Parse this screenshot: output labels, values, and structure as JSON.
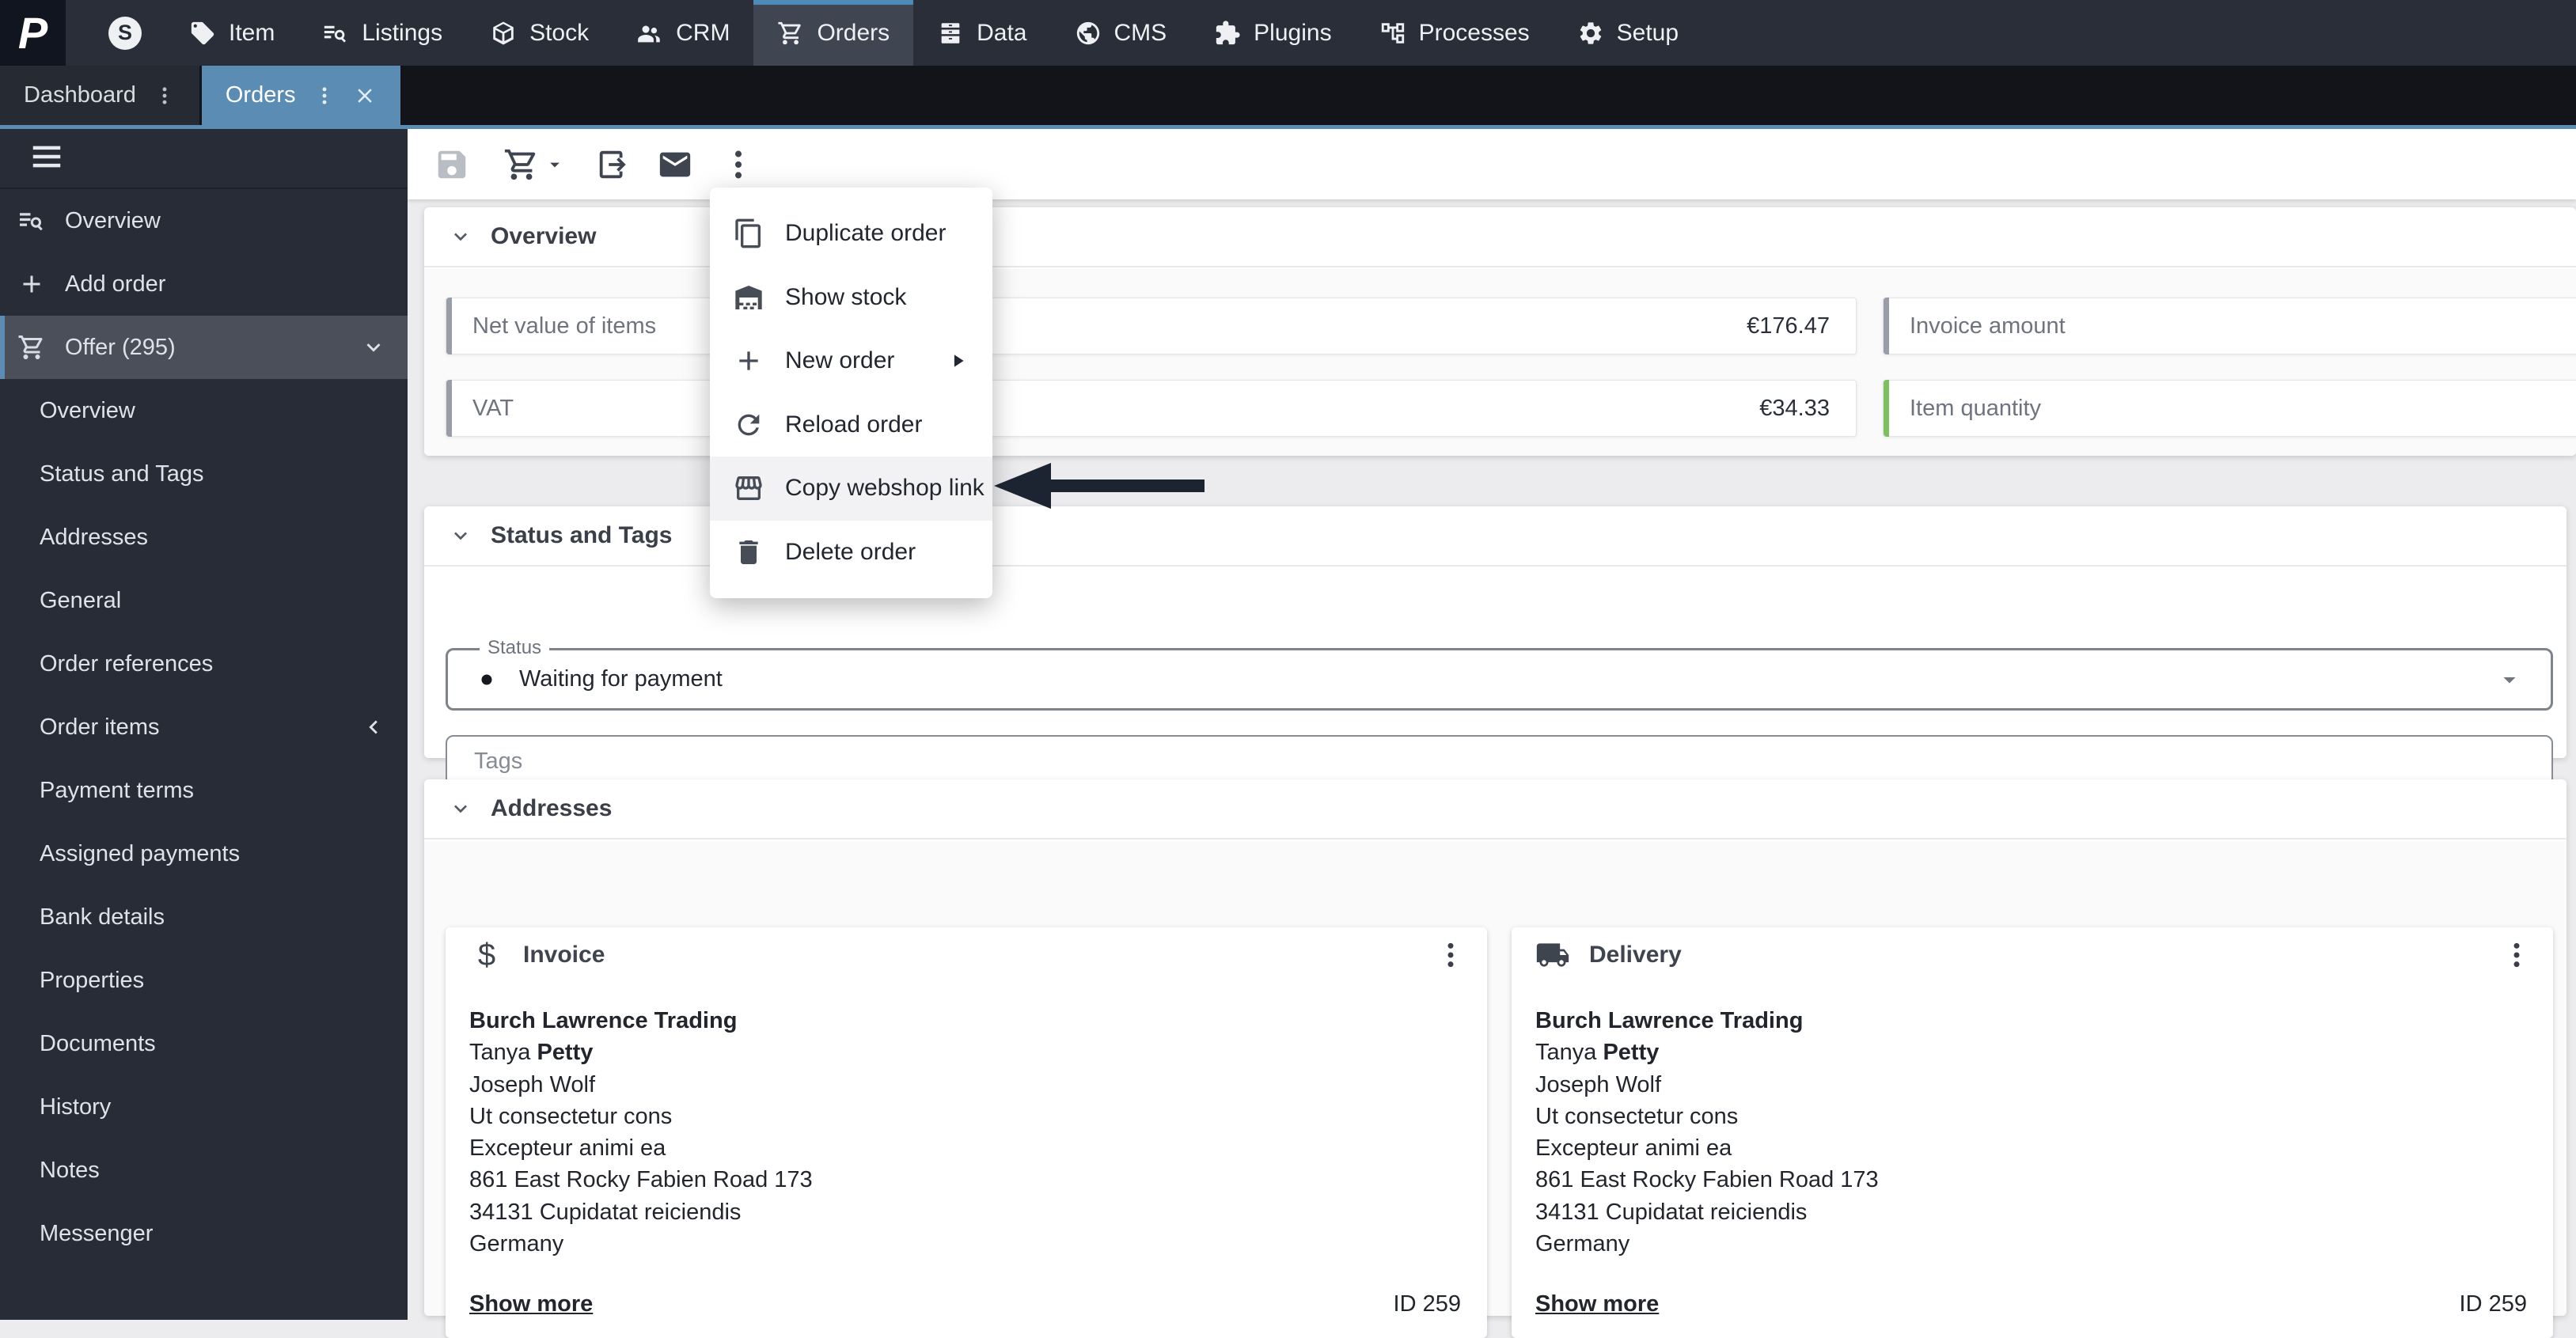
{
  "topnav": {
    "items": [
      {
        "icon": "s-badge",
        "label": ""
      },
      {
        "icon": "tag",
        "label": "Item"
      },
      {
        "icon": "listings",
        "label": "Listings"
      },
      {
        "icon": "stock",
        "label": "Stock"
      },
      {
        "icon": "crm",
        "label": "CRM"
      },
      {
        "icon": "cart",
        "label": "Orders",
        "active": true
      },
      {
        "icon": "data",
        "label": "Data"
      },
      {
        "icon": "cms",
        "label": "CMS"
      },
      {
        "icon": "plugins",
        "label": "Plugins"
      },
      {
        "icon": "processes",
        "label": "Processes"
      },
      {
        "icon": "setup",
        "label": "Setup"
      }
    ]
  },
  "tabs": {
    "items": [
      {
        "label": "Dashboard",
        "active": false,
        "closable": false
      },
      {
        "label": "Orders",
        "active": true,
        "closable": true
      }
    ]
  },
  "sidebar": {
    "items": [
      {
        "label": "Overview",
        "icon": "overview-search",
        "level": "top"
      },
      {
        "label": "Add order",
        "icon": "plus",
        "level": "top"
      },
      {
        "label": "Offer (295)",
        "icon": "cart",
        "level": "top",
        "active": true,
        "trailing": "chevron-down"
      },
      {
        "label": "Overview",
        "level": "sub"
      },
      {
        "label": "Status and Tags",
        "level": "sub"
      },
      {
        "label": "Addresses",
        "level": "sub"
      },
      {
        "label": "General",
        "level": "sub"
      },
      {
        "label": "Order references",
        "level": "sub"
      },
      {
        "label": "Order items",
        "level": "sub",
        "trailing": "chevron-left"
      },
      {
        "label": "Payment terms",
        "level": "sub"
      },
      {
        "label": "Assigned payments",
        "level": "sub"
      },
      {
        "label": "Bank details",
        "level": "sub"
      },
      {
        "label": "Properties",
        "level": "sub"
      },
      {
        "label": "Documents",
        "level": "sub"
      },
      {
        "label": "History",
        "level": "sub"
      },
      {
        "label": "Notes",
        "level": "sub"
      },
      {
        "label": "Messenger",
        "level": "sub"
      }
    ]
  },
  "toolbar": {
    "buttons": [
      {
        "icon": "save",
        "disabled": true
      },
      {
        "icon": "cart",
        "caret": true
      },
      {
        "icon": "export"
      },
      {
        "icon": "mail"
      },
      {
        "icon": "kebab"
      }
    ]
  },
  "context_menu": {
    "items": [
      {
        "icon": "copy",
        "label": "Duplicate order"
      },
      {
        "icon": "warehouse",
        "label": "Show stock"
      },
      {
        "icon": "plus",
        "label": "New order",
        "submenu": true
      },
      {
        "icon": "reload",
        "label": "Reload order"
      },
      {
        "icon": "store",
        "label": "Copy webshop link",
        "highlighted": true
      },
      {
        "icon": "trash",
        "label": "Delete order"
      }
    ]
  },
  "overview_section": {
    "title": "Overview",
    "fields": [
      {
        "label": "Net value of items",
        "value": "€176.47",
        "bar_color": "#999ea6",
        "row": 0,
        "col": "left"
      },
      {
        "label": "VAT",
        "value": "€34.33",
        "bar_color": "#999ea6",
        "row": 1,
        "col": "left"
      },
      {
        "label": "Invoice amount",
        "value": "",
        "bar_color": "#999ea6",
        "row": 0,
        "col": "right"
      },
      {
        "label": "Item quantity",
        "value": "",
        "bar_color": "#7cc15f",
        "row": 1,
        "col": "right"
      }
    ]
  },
  "status_section": {
    "title": "Status and Tags",
    "status_label": "Status",
    "status_value": "Waiting for payment",
    "tags_placeholder": "Tags"
  },
  "addresses_section": {
    "title": "Addresses",
    "cards": [
      {
        "icon": "dollar",
        "title": "Invoice",
        "lines": [
          [
            {
              "t": "Burch Lawrence Trading",
              "b": true
            }
          ],
          [
            {
              "t": "Tanya ",
              "b": false
            },
            {
              "t": "Petty",
              "b": true
            }
          ],
          [
            {
              "t": "Joseph Wolf",
              "b": false
            }
          ],
          [
            {
              "t": "Ut consectetur cons",
              "b": false
            }
          ],
          [
            {
              "t": "Excepteur animi ea",
              "b": false
            }
          ],
          [
            {
              "t": "861 East Rocky Fabien Road 173",
              "b": false
            }
          ],
          [
            {
              "t": "34131 Cupidatat reiciendis",
              "b": false
            }
          ],
          [
            {
              "t": "Germany",
              "b": false
            }
          ]
        ],
        "show_more": "Show more",
        "id_label": "ID 259"
      },
      {
        "icon": "truck",
        "title": "Delivery",
        "lines": [
          [
            {
              "t": "Burch Lawrence Trading",
              "b": true
            }
          ],
          [
            {
              "t": "Tanya ",
              "b": false
            },
            {
              "t": "Petty",
              "b": true
            }
          ],
          [
            {
              "t": "Joseph Wolf",
              "b": false
            }
          ],
          [
            {
              "t": "Ut consectetur cons",
              "b": false
            }
          ],
          [
            {
              "t": "Excepteur animi ea",
              "b": false
            }
          ],
          [
            {
              "t": "861 East Rocky Fabien Road 173",
              "b": false
            }
          ],
          [
            {
              "t": "34131 Cupidatat reiciendis",
              "b": false
            }
          ],
          [
            {
              "t": "Germany",
              "b": false
            }
          ]
        ],
        "show_more": "Show more",
        "id_label": "ID 259"
      }
    ]
  },
  "annotation": {
    "type": "arrow-left",
    "color": "#1b2430"
  },
  "colors": {
    "accent": "#5b8cb4",
    "green_bar": "#7cc15f",
    "gray_bar": "#999ea6",
    "logo_letter": "P"
  }
}
